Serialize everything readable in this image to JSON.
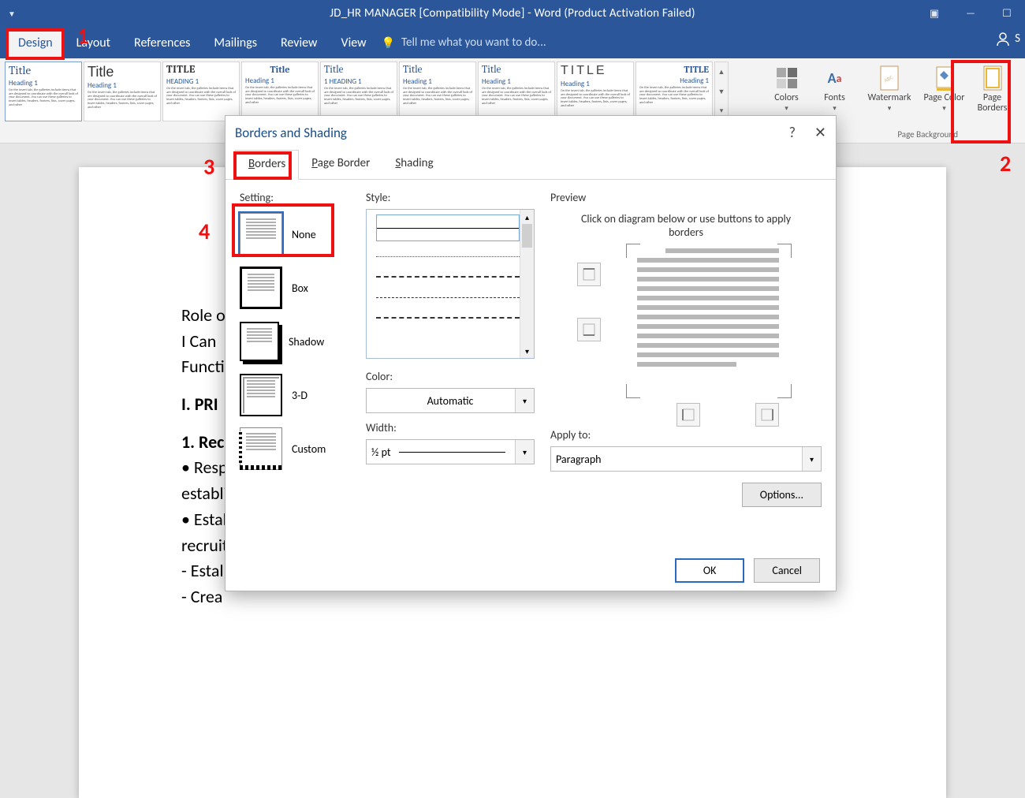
{
  "titlebar": {
    "title": "JD_HR MANAGER [Compatibility Mode] - Word (Product Activation Failed)"
  },
  "ribbon": {
    "tabs": [
      "Design",
      "Layout",
      "References",
      "Mailings",
      "Review",
      "View"
    ],
    "tellme": "Tell me what you want to do...",
    "signin": "S"
  },
  "styleset": {
    "title_word": "Title",
    "title_caps": "TITLE",
    "heading": "Heading 1",
    "heading_caps": "HEADING 1",
    "heading_num": "1   HEADING 1",
    "body": "On the Insert tab, the galleries include items that are designed to coordinate with the overall look of your document. You can use these galleries to insert tables, headers, footers, lists, cover pages, and other"
  },
  "ribbon_buttons": {
    "colors": "Colors",
    "fonts": "Fonts",
    "watermark": "Watermark",
    "page_color": "Page Color",
    "page_borders": "Page Borders",
    "group": "Page Background"
  },
  "doc": {
    "l1": "Role o                                                                                                                                                                 at",
    "l2": "I Can",
    "l3": "Functi",
    "s1": "I. PRI",
    "s2": "1. Rec",
    "b1": "• Resp",
    "b2": "establi",
    "b3": "• Estal",
    "b4": "recruit",
    "b5": "- Estal",
    "b6": "- Crea"
  },
  "dialog": {
    "title": "Borders and Shading",
    "tabs": {
      "borders": "Borders",
      "page_border": "Page Border",
      "shading": "Shading"
    },
    "setting": {
      "label": "Setting:",
      "none": "None",
      "box": "Box",
      "shadow": "Shadow",
      "threeD": "3-D",
      "custom": "Custom"
    },
    "style": {
      "label": "Style:",
      "color": "Color:",
      "color_val": "Automatic",
      "width": "Width:",
      "width_val": "½ pt"
    },
    "preview": {
      "label": "Preview",
      "hint": "Click on diagram below or use buttons to apply borders",
      "apply": "Apply to:",
      "apply_val": "Paragraph",
      "options": "Options..."
    },
    "buttons": {
      "ok": "OK",
      "cancel": "Cancel"
    }
  },
  "callouts": {
    "n1": "1",
    "n2": "2",
    "n3": "3",
    "n4": "4"
  }
}
